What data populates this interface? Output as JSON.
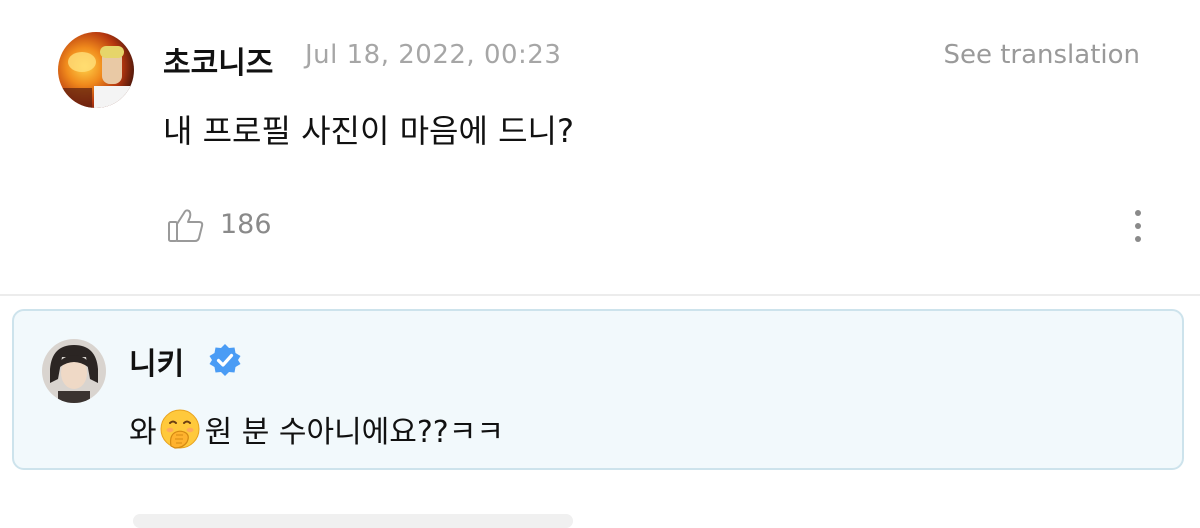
{
  "comment": {
    "username": "초코니즈",
    "timestamp": "Jul 18, 2022, 00:23",
    "translate_label": "See translation",
    "text": "내 프로필 사진이 마음에 드니?",
    "like_count": "186"
  },
  "reply": {
    "username": "니키",
    "verified": true,
    "text_before": "와",
    "emoji": "face-with-hand-over-mouth",
    "text_after": "원 분 수아니에요??ㅋㅋ"
  },
  "colors": {
    "reply_background": "#f2f9fc",
    "reply_border": "#cde3ec",
    "verified_badge": "#4a9cf5",
    "muted_text": "#a6a6a6"
  }
}
